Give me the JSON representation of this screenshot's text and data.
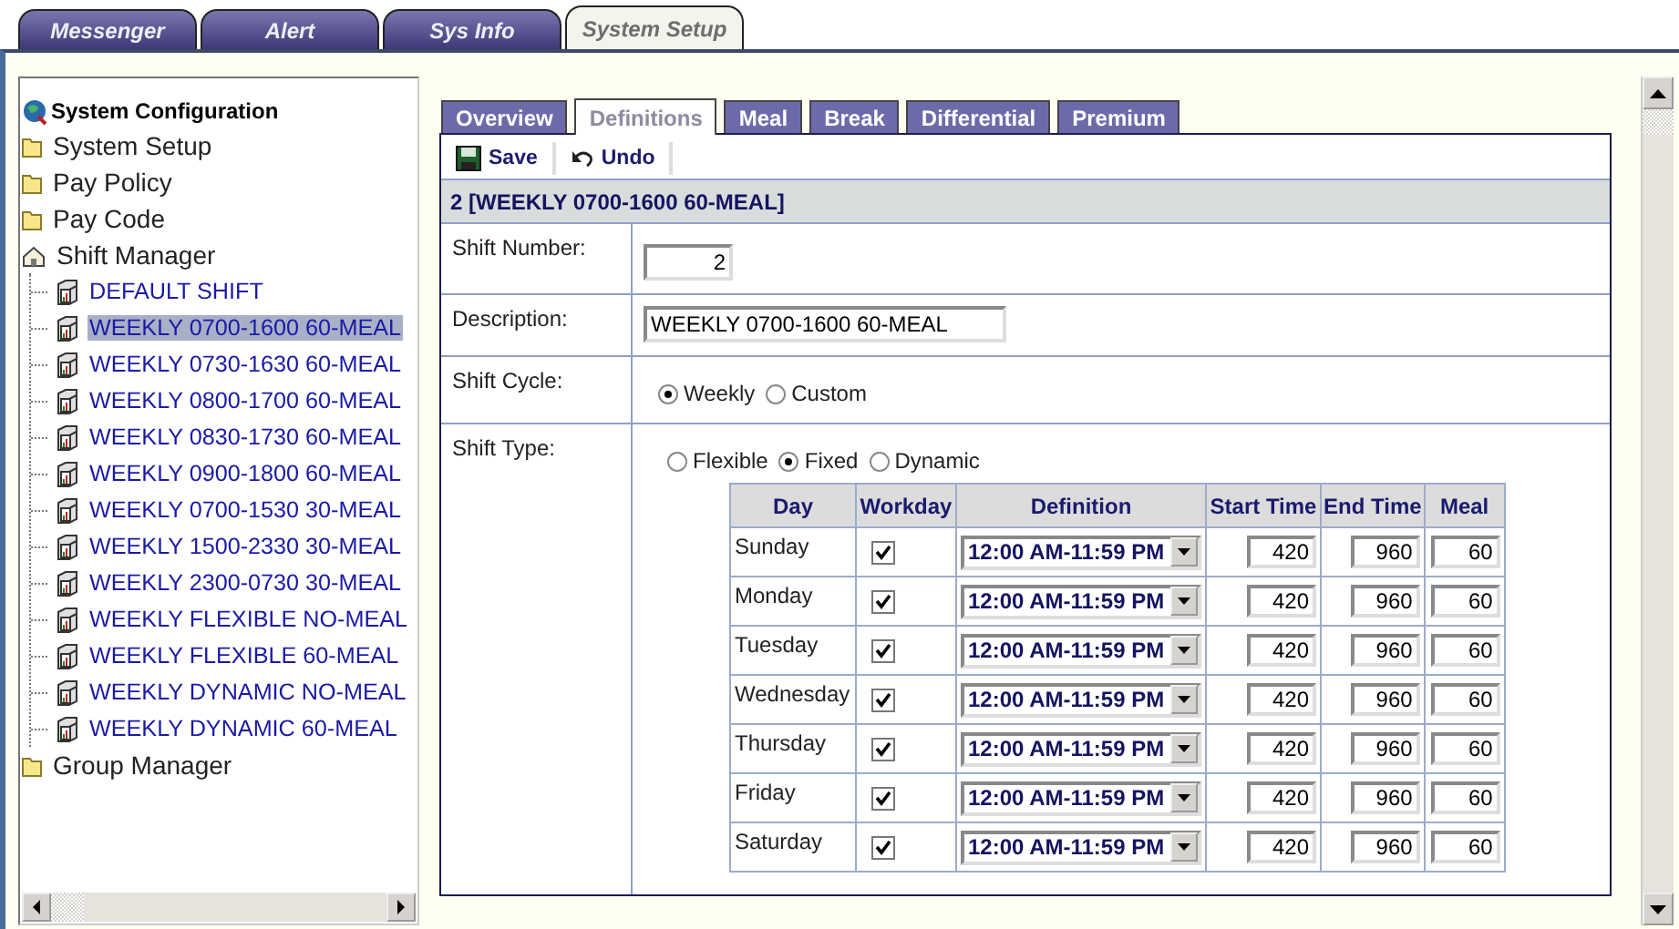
{
  "app_tabs": [
    {
      "label": "Messenger",
      "selected": false
    },
    {
      "label": "Alert",
      "selected": false
    },
    {
      "label": "Sys Info",
      "selected": false
    },
    {
      "label": "System Setup",
      "selected": true
    }
  ],
  "tree": {
    "label": "System Configuration",
    "children": [
      {
        "label": "System Setup",
        "kind": "folder",
        "selected": false
      },
      {
        "label": "Pay Policy",
        "kind": "folder",
        "selected": false
      },
      {
        "label": "Pay Code",
        "kind": "folder",
        "selected": false
      },
      {
        "label": "Shift Manager",
        "kind": "manager",
        "selected": false,
        "children": [
          {
            "label": "DEFAULT SHIFT",
            "kind": "shift",
            "selected": false
          },
          {
            "label": "WEEKLY 0700-1600 60-MEAL",
            "kind": "shift",
            "selected": true
          },
          {
            "label": "WEEKLY 0730-1630 60-MEAL",
            "kind": "shift",
            "selected": false
          },
          {
            "label": "WEEKLY 0800-1700 60-MEAL",
            "kind": "shift",
            "selected": false
          },
          {
            "label": "WEEKLY 0830-1730 60-MEAL",
            "kind": "shift",
            "selected": false
          },
          {
            "label": "WEEKLY 0900-1800 60-MEAL",
            "kind": "shift",
            "selected": false
          },
          {
            "label": "WEEKLY 0700-1530 30-MEAL",
            "kind": "shift",
            "selected": false
          },
          {
            "label": "WEEKLY 1500-2330 30-MEAL",
            "kind": "shift",
            "selected": false
          },
          {
            "label": "WEEKLY 2300-0730 30-MEAL",
            "kind": "shift",
            "selected": false
          },
          {
            "label": "WEEKLY FLEXIBLE NO-MEAL",
            "kind": "shift",
            "selected": false
          },
          {
            "label": "WEEKLY FLEXIBLE 60-MEAL",
            "kind": "shift",
            "selected": false
          },
          {
            "label": "WEEKLY DYNAMIC NO-MEAL",
            "kind": "shift",
            "selected": false
          },
          {
            "label": "WEEKLY DYNAMIC 60-MEAL",
            "kind": "shift",
            "selected": false
          }
        ]
      },
      {
        "label": "Group Manager",
        "kind": "folder",
        "selected": false
      }
    ]
  },
  "sub_tabs": [
    {
      "label": "Overview",
      "selected": false
    },
    {
      "label": "Definitions",
      "selected": true
    },
    {
      "label": "Meal",
      "selected": false
    },
    {
      "label": "Break",
      "selected": false
    },
    {
      "label": "Differential",
      "selected": false
    },
    {
      "label": "Premium",
      "selected": false
    }
  ],
  "toolbar": [
    {
      "label": "Save",
      "kind": "save"
    },
    {
      "label": "Undo",
      "kind": "undo"
    }
  ],
  "record_title": "2 [WEEKLY 0700-1600 60-MEAL]",
  "form": {
    "shift_number": {
      "label": "Shift Number:",
      "value": "2"
    },
    "description": {
      "label": "Description:",
      "value": "WEEKLY 0700-1600 60-MEAL"
    },
    "shift_cycle": {
      "label": "Shift Cycle:",
      "options": [
        {
          "label": "Weekly",
          "selected": true
        },
        {
          "label": "Custom",
          "selected": false
        }
      ]
    },
    "shift_type": {
      "label": "Shift Type:",
      "options": [
        {
          "label": "Flexible",
          "selected": false
        },
        {
          "label": "Fixed",
          "selected": true
        },
        {
          "label": "Dynamic",
          "selected": false
        }
      ]
    }
  },
  "schedule": {
    "columns": [
      "Day",
      "Workday",
      "Definition",
      "Start Time",
      "End Time",
      "Meal"
    ],
    "rows": [
      {
        "day": "Sunday",
        "workday": true,
        "definition": "12:00 AM-11:59 PM",
        "start_time": "420",
        "end_time": "960",
        "meal": "60"
      },
      {
        "day": "Monday",
        "workday": true,
        "definition": "12:00 AM-11:59 PM",
        "start_time": "420",
        "end_time": "960",
        "meal": "60"
      },
      {
        "day": "Tuesday",
        "workday": true,
        "definition": "12:00 AM-11:59 PM",
        "start_time": "420",
        "end_time": "960",
        "meal": "60"
      },
      {
        "day": "Wednesday",
        "workday": true,
        "definition": "12:00 AM-11:59 PM",
        "start_time": "420",
        "end_time": "960",
        "meal": "60"
      },
      {
        "day": "Thursday",
        "workday": true,
        "definition": "12:00 AM-11:59 PM",
        "start_time": "420",
        "end_time": "960",
        "meal": "60"
      },
      {
        "day": "Friday",
        "workday": true,
        "definition": "12:00 AM-11:59 PM",
        "start_time": "420",
        "end_time": "960",
        "meal": "60"
      },
      {
        "day": "Saturday",
        "workday": true,
        "definition": "12:00 AM-11:59 PM",
        "start_time": "420",
        "end_time": "960",
        "meal": "60"
      }
    ]
  }
}
